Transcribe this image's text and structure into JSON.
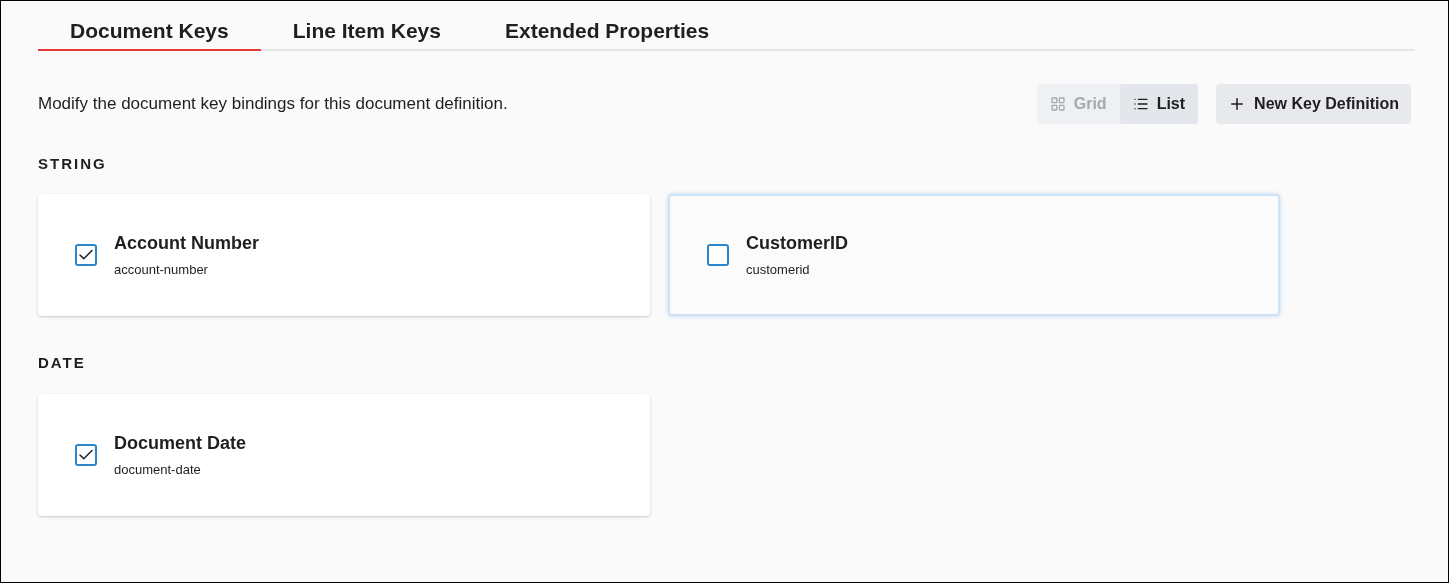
{
  "tabs": [
    {
      "label": "Document Keys",
      "selected": true
    },
    {
      "label": "Line Item Keys",
      "selected": false
    },
    {
      "label": "Extended Properties",
      "selected": false
    }
  ],
  "description": "Modify the document key bindings for this document definition.",
  "view_toggle": [
    {
      "label": "Grid",
      "kind": "grid",
      "selected": false
    },
    {
      "label": "List",
      "kind": "list",
      "selected": true
    }
  ],
  "new_button": {
    "label": "New Key Definition"
  },
  "groups": [
    {
      "heading": "STRING",
      "keys": [
        {
          "name": "Account Number",
          "slug": "account-number",
          "checked": true,
          "highlighted": false
        },
        {
          "name": "CustomerID",
          "slug": "customerid",
          "checked": false,
          "highlighted": true
        }
      ]
    },
    {
      "heading": "DATE",
      "keys": [
        {
          "name": "Document Date",
          "slug": "document-date",
          "checked": true,
          "highlighted": false
        }
      ]
    }
  ]
}
